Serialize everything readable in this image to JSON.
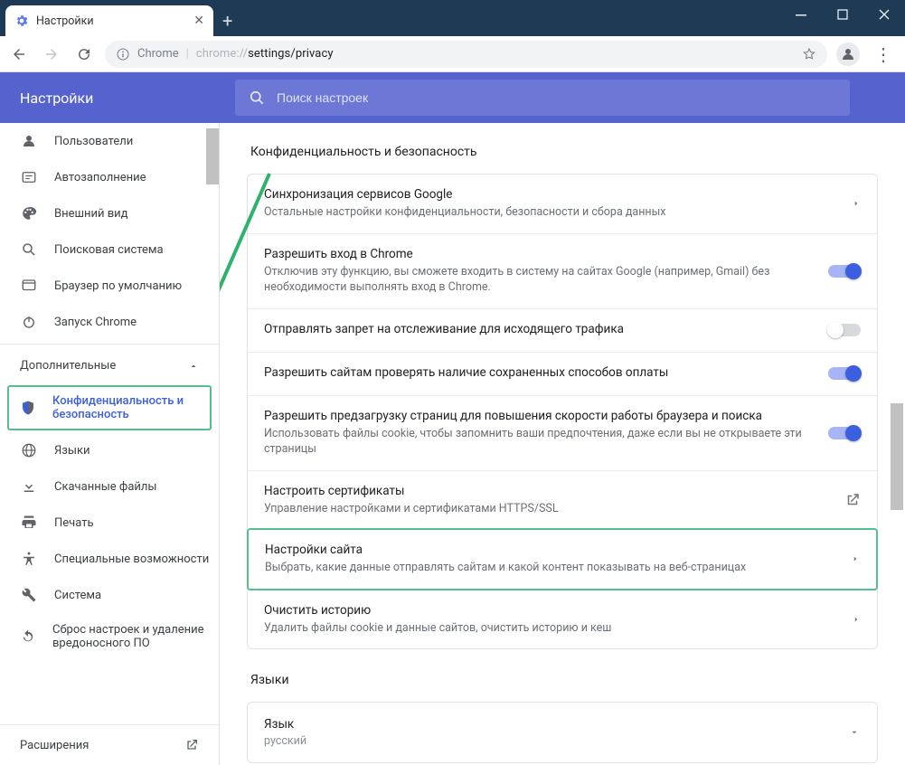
{
  "window": {
    "tab_title": "Настройки",
    "url_label_prefix": "Chrome",
    "url_dim": "chrome://",
    "url_rest": "settings/privacy"
  },
  "header": {
    "title": "Настройки",
    "search_placeholder": "Поиск настроек"
  },
  "sidebar": {
    "items_top": [
      {
        "icon": "user",
        "label": "Пользователи"
      },
      {
        "icon": "autofill",
        "label": "Автозаполнение"
      },
      {
        "icon": "palette",
        "label": "Внешний вид"
      },
      {
        "icon": "search",
        "label": "Поисковая система"
      },
      {
        "icon": "browser",
        "label": "Браузер по умолчанию"
      },
      {
        "icon": "power",
        "label": "Запуск Chrome"
      }
    ],
    "advanced_label": "Дополнительные",
    "items_bottom": [
      {
        "icon": "shield",
        "label": "Конфиденциальность и безопасность",
        "highlight": true
      },
      {
        "icon": "globe",
        "label": "Языки"
      },
      {
        "icon": "download",
        "label": "Скачанные файлы"
      },
      {
        "icon": "print",
        "label": "Печать"
      },
      {
        "icon": "a11y",
        "label": "Специальные возможности"
      },
      {
        "icon": "wrench",
        "label": "Система"
      },
      {
        "icon": "reset",
        "label": "Сброс настроек и удаление вредоносного ПО"
      }
    ],
    "extensions_label": "Расширения"
  },
  "main": {
    "section_title": "Конфиденциальность и безопасность",
    "rows": [
      {
        "title": "Синхронизация сервисов Google",
        "sub": "Остальные настройки конфиденциальности, безопасности и сбора данных",
        "ctrl": "chev"
      },
      {
        "title": "Разрешить вход в Chrome",
        "sub": "Отключив эту функцию, вы сможете входить в систему на сайтах Google (например, Gmail) без необходимости выполнять вход в Chrome.",
        "ctrl": "toggle_on"
      },
      {
        "title": "Отправлять запрет на отслеживание для исходящего трафика",
        "sub": "",
        "ctrl": "toggle_off"
      },
      {
        "title": "Разрешить сайтам проверять наличие сохраненных способов оплаты",
        "sub": "",
        "ctrl": "toggle_on"
      },
      {
        "title": "Разрешить предзагрузку страниц для повышения скорости работы браузера и поиска",
        "sub": "Использовать файлы cookie, чтобы запомнить ваши предпочтения, даже если вы не открываете эти страницы",
        "ctrl": "toggle_on"
      },
      {
        "title": "Настроить сертификаты",
        "sub": "Управление настройками и сертификатами HTTPS/SSL",
        "ctrl": "ext"
      },
      {
        "title": "Настройки сайта",
        "sub": "Выбрать, какие данные отправлять сайтам и какой контент показывать на веб-страницах",
        "ctrl": "chev",
        "highlight": true
      },
      {
        "title": "Очистить историю",
        "sub": "Удалить файлы cookie и данные сайтов, очистить историю и кеш",
        "ctrl": "chev"
      }
    ],
    "lang_section_title": "Языки",
    "lang_row_title": "Язык",
    "lang_row_sub": "русский"
  }
}
